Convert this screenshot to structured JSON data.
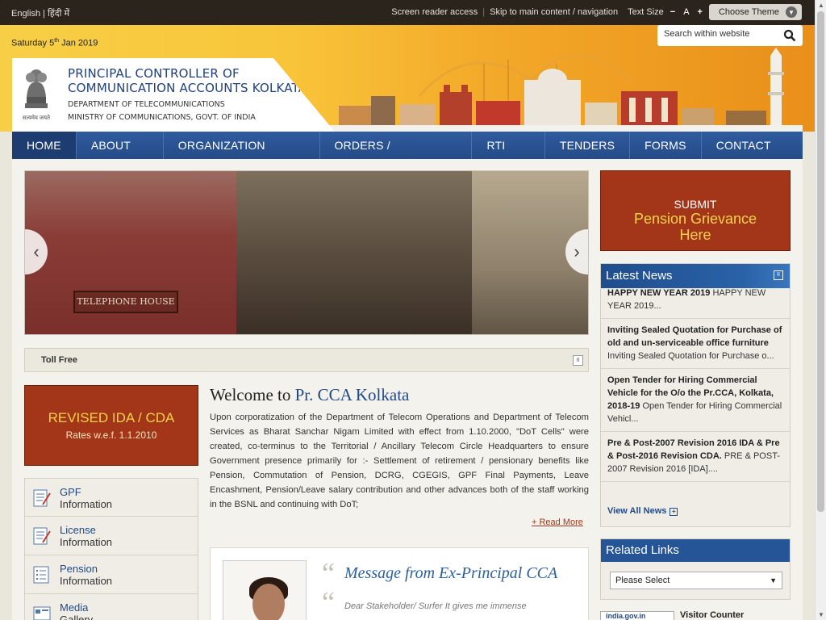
{
  "topbar": {
    "lang_english": "English",
    "lang_sep": "|",
    "lang_hindi": "हिंदी में",
    "screen_reader": "Screen reader access",
    "skip_link": "Skip to main content / navigation",
    "text_size_label": "Text Size",
    "text_minus": "−",
    "text_normal": "A",
    "text_plus": "+",
    "theme_label": "Choose Theme"
  },
  "header": {
    "date_prefix": "Saturday 5",
    "date_sup": "th",
    "date_suffix": " Jan 2019",
    "search_placeholder": "Search within website",
    "title_line1": "PRINCIPAL CONTROLLER OF",
    "title_line2": "COMMUNICATION ACCOUNTS KOLKATA",
    "sub_line1": "DEPARTMENT OF TELECOMMUNICATIONS",
    "sub_line2": "MINISTRY OF COMMUNICATIONS, GOVT. OF INDIA",
    "emblem_motto": "सत्यमेव जयते"
  },
  "nav": {
    "items": [
      "HOME",
      "ABOUT US",
      "ORGANIZATION CHART",
      "ORDERS / CIRCULARS",
      "RTI ACT",
      "TENDERS",
      "FORMS",
      "CONTACT US"
    ]
  },
  "slider": {
    "sign_text": "TELEPHONE HOUSE",
    "prev": "‹",
    "next": "›"
  },
  "ticker": {
    "text": "Toll Free"
  },
  "ida": {
    "line1": "REVISED IDA / CDA",
    "line2": "Rates w.e.f. 1.1.2010"
  },
  "info_links": [
    {
      "line1": "GPF",
      "line2": "Information"
    },
    {
      "line1": "License",
      "line2": "Information"
    },
    {
      "line1": "Pension",
      "line2": "Information"
    },
    {
      "line1": "Media",
      "line2": "Gallery"
    }
  ],
  "welcome": {
    "prefix": "Welcome to ",
    "highlight": "Pr. CCA Kolkata",
    "body": "Upon corporatization of the Department of Telecom Operations and  Department of Telecom Services as Bharat Sanchar Nigam Limited  with effect  from 1.10.2000, \"DoT Cells\" were created, co-terminus to the Territorial / Ancillary Telecom Circle Headquarters to ensure Government presence primarily for :- Settlement of retirement / pensionary benefits like Pension, Commutation of  Pension, DCRG, CGEGIS, GPF Final Payments, Leave  Encashment,  Pension/Leave  salary contribution and other advances both of the staff working in the BSNL and continuing with DoT;",
    "read_more": "+ Read More"
  },
  "message": {
    "title": "Message from Ex-Principal CCA",
    "body": "Dear Stakeholder/ Surfer It gives me immense",
    "quote_open": "“"
  },
  "pension_box": {
    "line1": "SUBMIT",
    "line2": "Pension Grievance",
    "line3": "Here"
  },
  "news": {
    "title": "Latest News",
    "pause": "II",
    "items": [
      {
        "bold": "HAPPY NEW YEAR 2019",
        "text": "HAPPY NEW YEAR 2019..."
      },
      {
        "bold": "Inviting Sealed Quotation for Purchase of old and un-serviceable office furniture",
        "text": "Inviting Sealed Quotation for Purchase o..."
      },
      {
        "bold": "Open Tender for Hiring Commercial Vehicle for the O/o the Pr.CCA, Kolkata, 2018-19",
        "text": "Open Tender for Hiring Commercial Vehicl..."
      },
      {
        "bold": "Pre & Post-2007 Revision 2016 IDA & Pre & Post-2016 Revision CDA.",
        "text": "PRE & POST-2007 Revision 2016 [IDA]...."
      }
    ],
    "view_all": "View All News",
    "view_all_icon": "+"
  },
  "related": {
    "title": "Related Links",
    "select_value": "Please Select",
    "dd": "▼"
  },
  "visitor": {
    "badge": "india.gov.in",
    "label": "Visitor Counter"
  },
  "colors": {
    "brand_blue": "#255596",
    "accent_red": "#a33618",
    "accent_gold": "#f4d34a"
  },
  "icons": {
    "search": "search-icon",
    "chevron": "chevron-down-icon",
    "pause": "pause-icon"
  }
}
